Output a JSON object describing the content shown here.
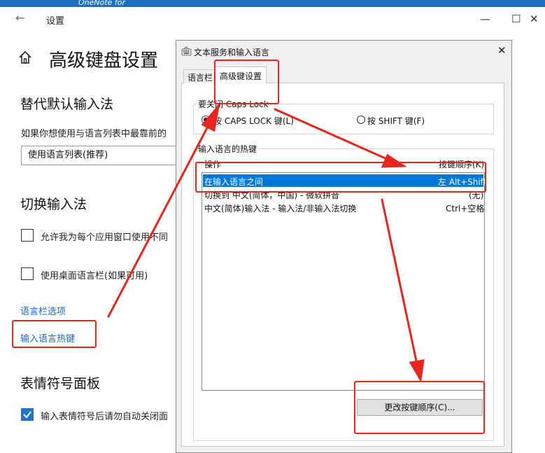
{
  "window": {
    "top_app": "OneNote for",
    "back_icon": "back-arrow-icon",
    "title": "设置",
    "minimize": "—",
    "maximize": "☐",
    "close": "✕"
  },
  "page": {
    "home_icon": "home-icon",
    "title": "高级键盘设置"
  },
  "override": {
    "heading": "替代默认输入法",
    "description": "如果你想使用与语言列表中最靠前的",
    "dropdown_value": "使用语言列表(推荐)"
  },
  "switch": {
    "heading": "切换输入法",
    "checkbox1_label": "允许我为每个应用窗口使用不同",
    "checkbox2_label": "使用桌面语言栏(如果可用)",
    "link_langbar": "语言栏选项",
    "link_hotkeys": "输入语言热键"
  },
  "emoji": {
    "heading": "表情符号面板",
    "checkbox_label": "输入表情符号后请勿自动关闭面"
  },
  "dialog": {
    "icon": "keyboard-icon",
    "title": "文本服务和输入语言",
    "close": "✕",
    "tabs": [
      "语言栏",
      "高级键设置"
    ],
    "capslock_group": "要关闭 Caps Lock",
    "radio_caps": "按 CAPS LOCK 键(L)",
    "radio_shift": "按 SHIFT 键(F)",
    "hotkey_group": "输入语言的热键",
    "col_action": "操作",
    "col_keys": "按键顺序(K)",
    "rows": [
      {
        "action": "在输入语言之间",
        "keys": "左 Alt+Shift"
      },
      {
        "action": "切换到 中文(简体，中国) - 微软拼音",
        "keys": "(无)"
      },
      {
        "action": "中文(简体)输入法 - 输入法/非输入法切换",
        "keys": "Ctrl+空格"
      }
    ],
    "change_button": "更改按键顺序(C)..."
  },
  "colors": {
    "accent": "#1e73d2",
    "link": "#1a66c2",
    "selection": "#0078d7",
    "annotation": "#e8251e"
  }
}
